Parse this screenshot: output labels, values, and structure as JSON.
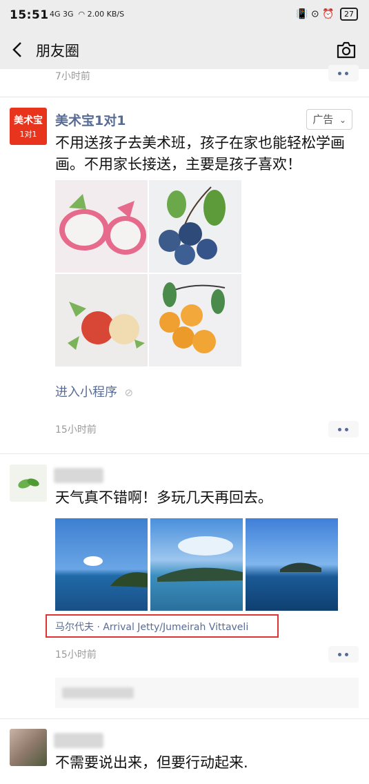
{
  "status": {
    "time": "15:51",
    "network_speed": "2.00 KB/S",
    "signal": "4G 3G",
    "battery": "27"
  },
  "nav": {
    "title": "朋友圈"
  },
  "previous_post": {
    "time": "7小时前"
  },
  "ad_post": {
    "avatar_text_top": "美术宝",
    "avatar_text_bottom": "1对1",
    "name": "美术宝1对1",
    "ad_label": "广告",
    "text": "不用送孩子去美术班，孩子在家也能轻松学画画。不用家长接送，主要是孩子喜欢！",
    "images": [
      "dragon-fruit",
      "blueberries",
      "apples",
      "oranges"
    ],
    "link": "进入小程序",
    "time": "15小时前"
  },
  "post2": {
    "text": "天气真不错啊！多玩几天再回去。",
    "images": [
      "sea-1",
      "sea-2",
      "sea-3"
    ],
    "location": "马尔代夫 · Arrival Jetty/Jumeirah Vittaveli",
    "time": "15小时前"
  },
  "post3": {
    "text": "不需要说出来，但要行动起来."
  },
  "colors": {
    "link": "#576b95",
    "bar_bg": "#ededed",
    "highlight": "#dd3333"
  }
}
